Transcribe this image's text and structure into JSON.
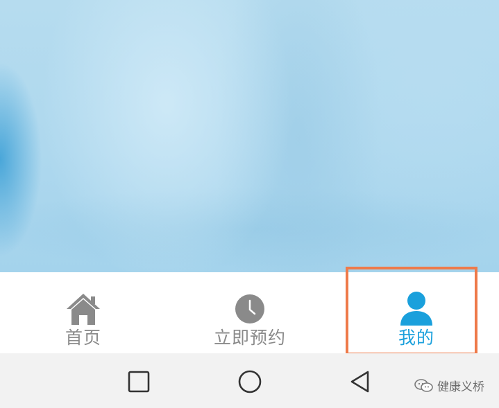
{
  "tabs": [
    {
      "id": "home",
      "label": "首页",
      "icon": "home-icon",
      "active": false
    },
    {
      "id": "book",
      "label": "立即预约",
      "icon": "clock-icon",
      "active": false
    },
    {
      "id": "mine",
      "label": "我的",
      "icon": "person-icon",
      "active": true
    }
  ],
  "nav": {
    "recents": "square-icon",
    "home": "circle-icon",
    "back": "triangle-back-icon"
  },
  "watermark": {
    "text": "健康义桥"
  },
  "colors": {
    "active_tab": "#1aa0dc",
    "inactive_tab": "#8a8a8a",
    "highlight_border": "#ee7a4a",
    "navbar_bg": "#f2f2f2"
  }
}
